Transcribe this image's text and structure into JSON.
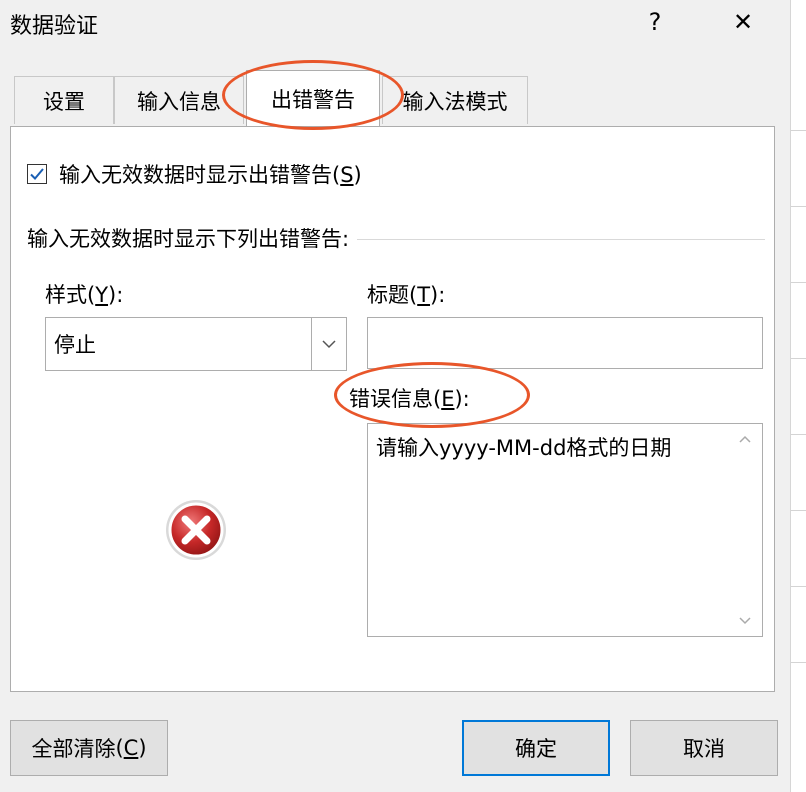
{
  "window": {
    "title": "数据验证",
    "help_glyph": "?",
    "close_glyph": "✕"
  },
  "tabs": [
    {
      "label": "设置"
    },
    {
      "label": "输入信息"
    },
    {
      "label": "出错警告",
      "active": true
    },
    {
      "label": "输入法模式"
    }
  ],
  "panel": {
    "checkbox_checked": true,
    "checkbox_label": "输入无效数据时显示出错警告",
    "checkbox_accel": "S",
    "group_label": "输入无效数据时显示下列出错警告:",
    "style_label": "样式",
    "style_accel": "Y",
    "style_value": "停止",
    "title_label": "标题",
    "title_accel": "T",
    "title_value": "",
    "message_label": "错误信息",
    "message_accel": "E",
    "message_value": "请输入yyyy-MM-dd格式的日期"
  },
  "buttons": {
    "clear_all": "全部清除",
    "clear_all_accel": "C",
    "ok": "确定",
    "cancel": "取消"
  },
  "colors": {
    "annotation": "#e8562a",
    "default_button_border": "#0078d7",
    "error_icon": "#c62828"
  }
}
